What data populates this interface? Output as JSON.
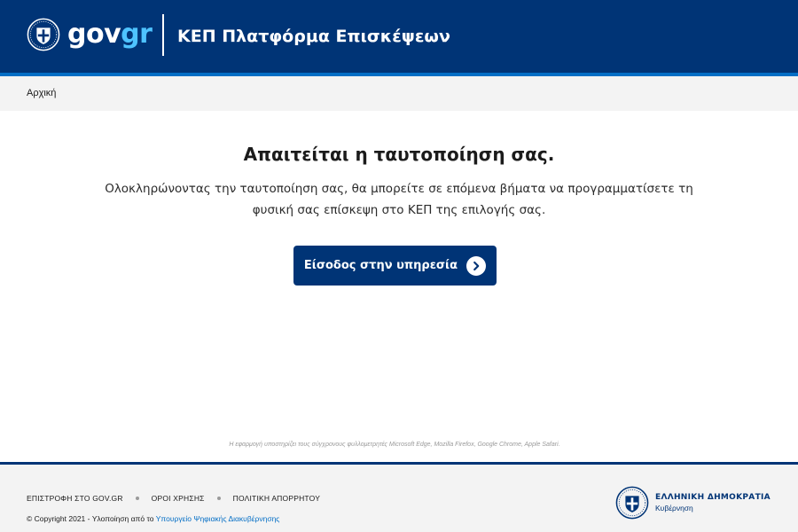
{
  "header": {
    "logo": {
      "part1": "gov",
      "part2": "gr",
      "colors": {
        "part1": "#ffffff",
        "part2": "#4ec3ff"
      }
    },
    "emblem_icon": "greek-coat-of-arms-icon",
    "app_title": "ΚΕΠ Πλατφόρμα Επισκέψεων",
    "colors": {
      "background": "#003476",
      "accent": "#046ec5"
    }
  },
  "breadcrumb": {
    "items": [
      {
        "label": "Αρχική"
      }
    ]
  },
  "main": {
    "heading": "Απαιτείται η ταυτοποίηση σας.",
    "description": "Ολοκληρώνοντας την ταυτοποίηση σας, θα μπορείτε σε επόμενα βήματα να προγραμματίσετε τη φυσική σας επίσκεψη στο ΚΕΠ της επιλογής σας.",
    "login_button": {
      "label": "Είσοδος στην υπηρεσία",
      "icon": "chevron-right-circle-icon"
    },
    "browser_note": "Η εφαρμογή υποστηρίζει τους σύγχρονους φυλλομετρητές Microsoft Edge, Mozilla Firefox, Google Chrome, Apple Safari."
  },
  "footer": {
    "links": [
      {
        "label": "ΕΠΙΣΤΡΟΦΗ ΣΤΟ GOV.GR"
      },
      {
        "label": "ΟΡΟΙ ΧΡΗΣΗΣ"
      },
      {
        "label": "ΠΟΛΙΤΙΚΗ ΑΠΟΡΡΗΤΟΥ"
      }
    ],
    "copyright_prefix": "© Copyright 2021 - Υλοποίηση από το",
    "ministry_link": "Υπουργείο Ψηφιακής Διακυβέρνησης",
    "hellenic_title": "ΕΛΛΗΝΙΚΗ ΔΗΜΟΚΡΑΤΙΑ",
    "hellenic_subtitle": "Κυβέρνηση",
    "emblem_icon": "greek-coat-of-arms-icon"
  }
}
